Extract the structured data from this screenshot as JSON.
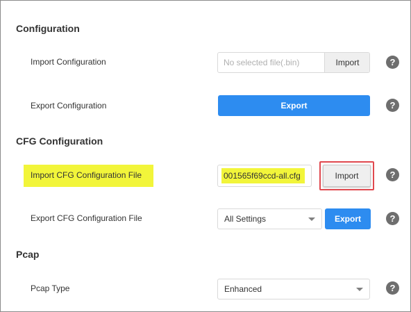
{
  "sections": {
    "configuration": {
      "title": "Configuration",
      "import_label": "Import Configuration",
      "import_placeholder": "No selected file(.bin)",
      "import_button": "Import",
      "export_label": "Export Configuration",
      "export_button": "Export"
    },
    "cfg": {
      "title": "CFG Configuration",
      "import_label": "Import CFG Configuration File",
      "import_file_value": "001565f69ccd-all.cfg",
      "import_button": "Import",
      "export_label": "Export CFG Configuration File",
      "export_select_value": "All Settings",
      "export_button": "Export"
    },
    "pcap": {
      "title": "Pcap",
      "type_label": "Pcap Type",
      "type_select_value": "Enhanced"
    }
  },
  "help_glyph": "?",
  "colors": {
    "primary_button": "#2d8cf0",
    "highlight": "#f2f53a",
    "annotation_box": "#e0484e",
    "help_icon": "#6e6e6e"
  },
  "icons": {
    "help": "help-icon",
    "dropdown": "chevron-down-icon"
  }
}
